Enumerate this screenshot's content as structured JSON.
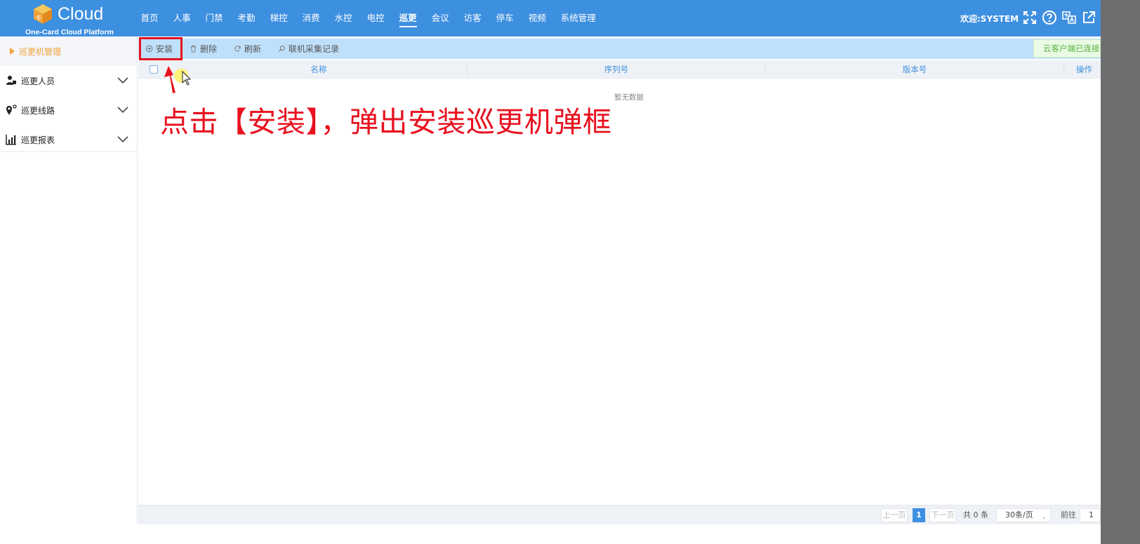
{
  "app": {
    "logo_text": "Cloud",
    "logo_subtitle": "One-Card Cloud Platform",
    "logo_badge": "卡"
  },
  "nav": {
    "items": [
      "首页",
      "人事",
      "门禁",
      "考勤",
      "梯控",
      "消费",
      "水控",
      "电控",
      "巡更",
      "会议",
      "访客",
      "停车",
      "视频",
      "系统管理"
    ],
    "active_index": 8
  },
  "header": {
    "welcome": "欢迎:SYSTEM",
    "icons": [
      "fullscreen-icon",
      "help-icon",
      "translate-icon",
      "external-link-icon"
    ]
  },
  "sidebar": {
    "active_item": "巡更机管理",
    "groups": [
      {
        "label": "巡更人员",
        "icon": "person-icon"
      },
      {
        "label": "巡更线路",
        "icon": "route-pin-icon"
      },
      {
        "label": "巡更报表",
        "icon": "bar-chart-icon"
      }
    ]
  },
  "toolbar": {
    "install": "安装",
    "delete": "删除",
    "refresh": "刷新",
    "online_records": "联机采集记录",
    "cloud_status": "云客户端已连接"
  },
  "table": {
    "columns": [
      "名称",
      "序列号",
      "版本号",
      "操作"
    ],
    "empty_text": "暂无数据",
    "rows": []
  },
  "annotation": {
    "text": "点击【安装】，弹出安装巡更机弹框"
  },
  "pagination": {
    "prev": "上一页",
    "current_page": "1",
    "next": "下一页",
    "total": "共 0 条",
    "page_size": "30条/页",
    "goto_label": "前往",
    "goto_value": "1"
  },
  "colors": {
    "brand_blue": "#3d8fe0",
    "toolbar_bg": "#bfe0fb",
    "accent_orange": "#f0a23a",
    "annotation_red": "#e8111f",
    "status_green": "#56b13b"
  }
}
